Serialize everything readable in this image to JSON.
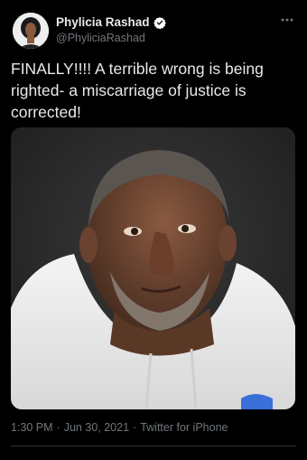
{
  "author": {
    "display_name": "Phylicia Rashad",
    "handle": "@PhyliciaRashad",
    "verified_icon": "verified-badge-icon",
    "more_icon": "more-options-icon"
  },
  "tweet": {
    "text": "FINALLY!!!! A terrible wrong is being righted- a miscarriage of justice is corrected!",
    "time": "1:30 PM",
    "separator": "·",
    "date": "Jun 30, 2021",
    "source": "Twitter for iPhone"
  },
  "colors": {
    "background": "#000000",
    "text": "#e7e9ea",
    "secondary_text": "#71767b",
    "verified": "#ffffff"
  }
}
